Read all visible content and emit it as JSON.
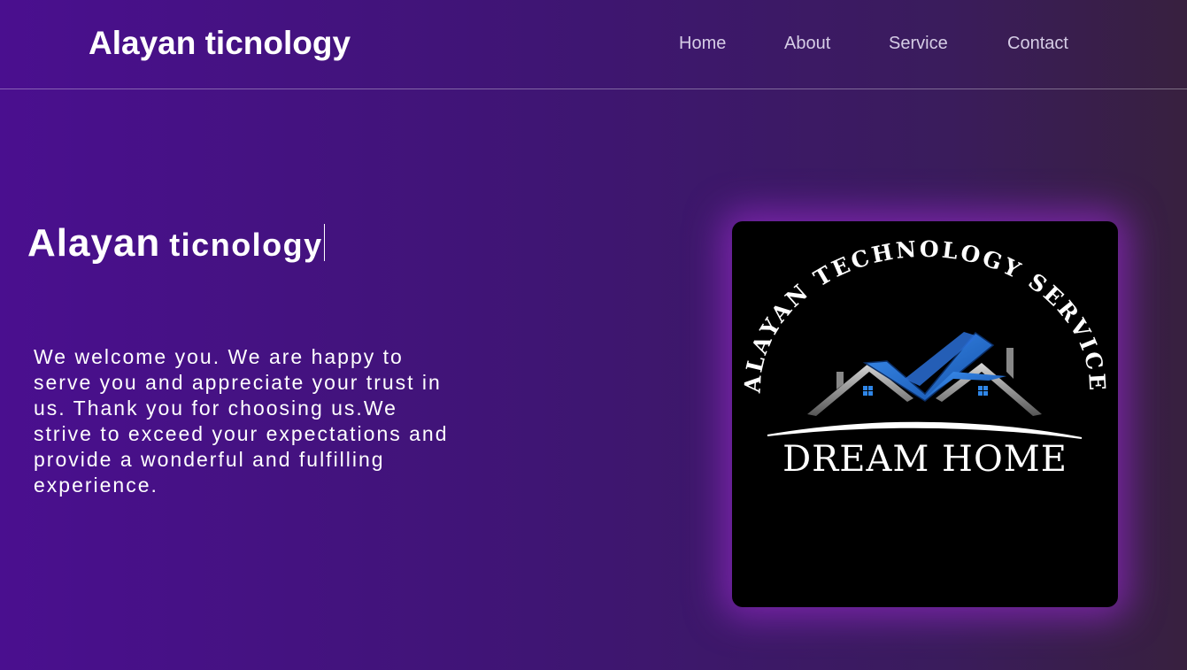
{
  "header": {
    "brand": "Alayan ticnology",
    "nav": [
      {
        "label": "Home"
      },
      {
        "label": "About"
      },
      {
        "label": "Service"
      },
      {
        "label": "Contact"
      }
    ]
  },
  "hero": {
    "title_big": "Alayan",
    "title_small": "ticnology",
    "paragraph": "We welcome you. We are happy to serve you and appreciate your trust in us. Thank you for choosing us.We strive to exceed your expectations and provide a wonderful and fulfilling experience."
  },
  "logo_image": {
    "arc_text": "ALAYAN TECHNOLOGY SERVICE",
    "brand_text": "DREAM HOME"
  },
  "colors": {
    "background_start": "#4a0f8f",
    "background_end": "#38203f",
    "nav_text": "#d6cde6",
    "glow": "#8c28be",
    "roof_blue": "#1e6fd0"
  }
}
